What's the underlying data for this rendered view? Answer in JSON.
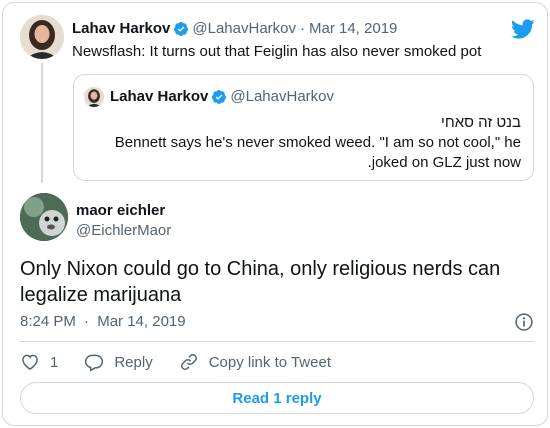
{
  "parent_tweet": {
    "name": "Lahav Harkov",
    "handle": "@LahavHarkov",
    "separator": "·",
    "date": "Mar 14, 2019",
    "text": "Newsflash: It turns out that Feiglin has also never smoked pot"
  },
  "quoted_tweet": {
    "name": "Lahav Harkov",
    "handle": "@LahavHarkov",
    "line1": "בנט זה סאחי",
    "line2": "Bennett says he's never smoked weed. \"I am so not cool,\" he",
    "line3": ".joked on GLZ just now"
  },
  "main_tweet": {
    "name": "maor eichler",
    "handle": "@EichlerMaor",
    "text": "Only Nixon could go to China, only religious nerds can legalize marijuana",
    "time": "8:24 PM",
    "separator": "·",
    "date": "Mar 14, 2019"
  },
  "actions": {
    "like_count": "1",
    "reply_label": "Reply",
    "copy_label": "Copy link to Tweet"
  },
  "read_replies_label": "Read 1 reply",
  "colors": {
    "brand_blue": "#1d9bf0",
    "text_primary": "#0f1419",
    "text_secondary": "#536471",
    "border": "#cfd9de"
  },
  "icons": [
    "twitter-bird-icon",
    "verified-badge-icon",
    "info-icon",
    "heart-icon",
    "reply-icon",
    "link-icon"
  ]
}
